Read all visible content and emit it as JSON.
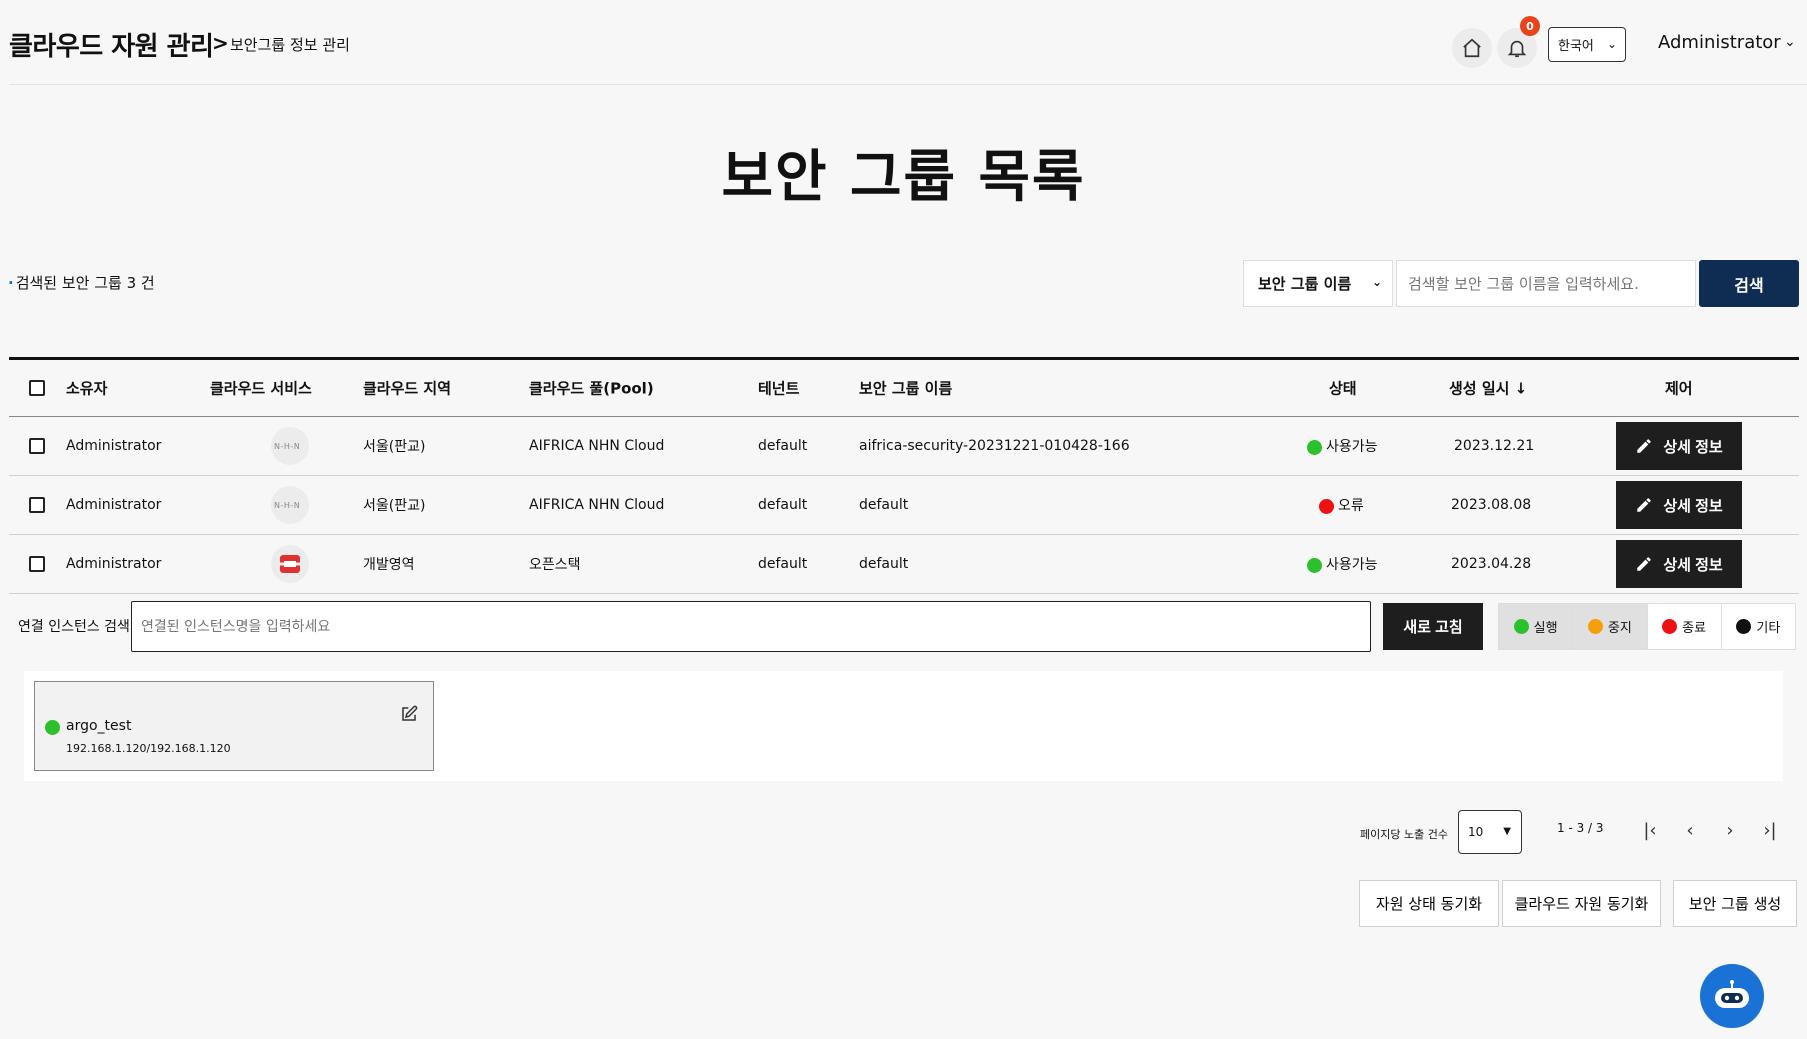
{
  "header": {
    "app_title": "클라우드 자원 관리",
    "breadcrumb_sep": ">",
    "breadcrumb": "보안그룹 정보 관리",
    "notification_count": "0",
    "language": "한국어",
    "user": "Administrator"
  },
  "page_title": "보안 그룹 목록",
  "result_count": "검색된 보안 그룹 3 건",
  "search": {
    "type_selected": "보안 그룹 이름",
    "placeholder": "검색할 보안 그룹 이름을 입력하세요.",
    "button": "검색"
  },
  "table": {
    "headers": {
      "owner": "소유자",
      "service": "클라우드 서비스",
      "region": "클라우드 지역",
      "pool": "클라우드 풀(Pool)",
      "tenant": "테넌트",
      "sg_name": "보안 그룹 이름",
      "status": "상태",
      "created": "생성 일시 ↓",
      "control": "제어"
    },
    "rows": [
      {
        "owner": "Administrator",
        "service_icon": "nhn-logo",
        "region": "서울(판교)",
        "pool": "AIFRICA NHN Cloud",
        "tenant": "default",
        "sg_name": "aifrica-security-20231221-010428-166",
        "status": "사용가능",
        "status_color": "#2cc12c",
        "created": "2023.12.21",
        "action": "상세 정보"
      },
      {
        "owner": "Administrator",
        "service_icon": "nhn-logo",
        "region": "서울(판교)",
        "pool": "AIFRICA NHN Cloud",
        "tenant": "default",
        "sg_name": "default",
        "status": "오류",
        "status_color": "#ee1111",
        "created": "2023.08.08",
        "action": "상세 정보"
      },
      {
        "owner": "Administrator",
        "service_icon": "openstack-logo",
        "region": "개발영역",
        "pool": "오픈스택",
        "tenant": "default",
        "sg_name": "default",
        "status": "사용가능",
        "status_color": "#2cc12c",
        "created": "2023.04.28",
        "action": "상세 정보"
      }
    ]
  },
  "instance_search": {
    "label": "연결 인스턴스 검색",
    "placeholder": "연결된 인스턴스명을 입력하세요",
    "refresh": "새로 고침",
    "legend": [
      {
        "label": "실행",
        "color": "#2cc12c"
      },
      {
        "label": "중지",
        "color": "#f5a00a"
      },
      {
        "label": "종료",
        "color": "#ee1111"
      },
      {
        "label": "기타",
        "color": "#111111"
      }
    ]
  },
  "instances": [
    {
      "name": "argo_test",
      "ip": "192.168.1.120/192.168.1.120",
      "status_color": "#2cc12c"
    }
  ],
  "pagination": {
    "per_page_label": "페이지당 노출 건수",
    "per_page": "10",
    "info": "1 - 3 / 3"
  },
  "actions": {
    "sync_status": "자원 상태 동기화",
    "sync_cloud": "클라우드 자원 동기화",
    "create": "보안 그룹 생성"
  }
}
